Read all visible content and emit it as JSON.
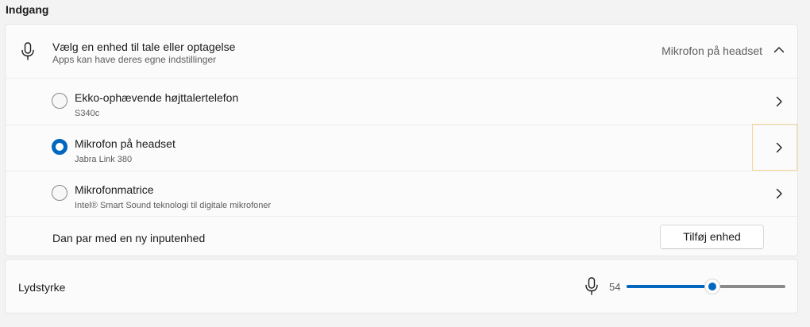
{
  "section": {
    "title": "Indgang"
  },
  "input_device": {
    "title": "Vælg en enhed til tale eller optagelse",
    "subtitle": "Apps kan have deres egne indstillinger",
    "selected_value": "Mikrofon på headset",
    "expanded_icon": "chevron-up-icon",
    "devices": [
      {
        "name": "Ekko-ophævende højttalertelefon",
        "detail": "S340c",
        "selected": false
      },
      {
        "name": "Mikrofon på headset",
        "detail": "Jabra Link 380",
        "selected": true
      },
      {
        "name": "Mikrofonmatrice",
        "detail": "Intel® Smart Sound teknologi til digitale mikrofoner",
        "selected": false
      }
    ],
    "pair_label": "Dan par med en ny inputenhed",
    "add_button_label": "Tilføj enhed"
  },
  "volume": {
    "label": "Lydstyrke",
    "value": "54",
    "fraction": 0.54,
    "icon": "microphone-icon"
  },
  "colors": {
    "accent": "#0067c0",
    "track": "#8a8a8a",
    "focus_outline": "#f5d69a"
  }
}
